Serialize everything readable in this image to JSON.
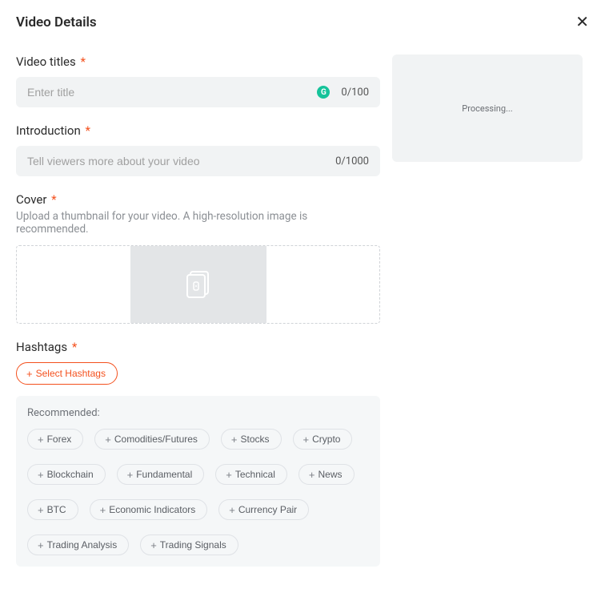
{
  "header": {
    "title": "Video Details"
  },
  "title_field": {
    "label": "Video titles",
    "required_marker": "*",
    "placeholder": "Enter title",
    "value": "",
    "counter": "0/100"
  },
  "intro_field": {
    "label": "Introduction",
    "required_marker": "*",
    "placeholder": "Tell viewers more about your video",
    "value": "",
    "counter": "0/1000"
  },
  "cover_field": {
    "label": "Cover",
    "required_marker": "*",
    "hint": "Upload a thumbnail for your video. A high-resolution image is recommended."
  },
  "preview": {
    "status": "Processing..."
  },
  "hashtags_field": {
    "label": "Hashtags",
    "required_marker": "*",
    "select_button_label": "Select Hashtags",
    "recommended_label": "Recommended:",
    "recommended": [
      "Forex",
      "Comodities/Futures",
      "Stocks",
      "Crypto",
      "Blockchain",
      "Fundamental",
      "Technical",
      "News",
      "BTC",
      "Economic Indicators",
      "Currency Pair",
      "Trading Analysis",
      "Trading Signals"
    ]
  }
}
